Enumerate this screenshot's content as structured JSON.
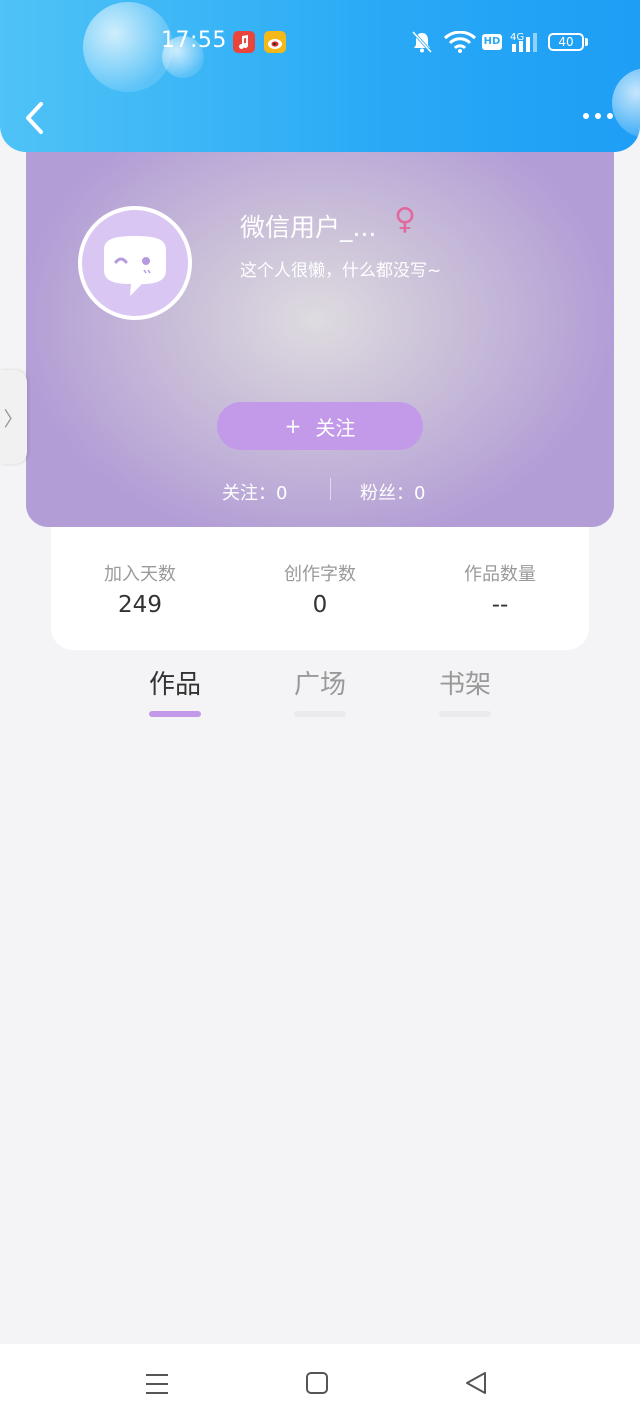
{
  "status_bar": {
    "time": "17:55",
    "battery": "40",
    "network": "4G",
    "hd_label": "HD",
    "app_icons": [
      "music-app-icon",
      "weibo-icon"
    ],
    "status_icons": [
      "bell-muted-icon",
      "wifi-icon",
      "hd-icon",
      "signal-4g-icon",
      "battery-icon"
    ]
  },
  "header": {
    "back_icon": "chevron-left-icon",
    "more_icon": "more-horizontal-icon",
    "colors": {
      "gradient_start": "#4fc3f7",
      "gradient_end": "#1e9ef5"
    }
  },
  "profile": {
    "username": "微信用户_...",
    "gender_symbol": "♀",
    "bio": "这个人很懒，什么都没写~",
    "follow_button": {
      "plus": "+",
      "label": "关注"
    },
    "following": {
      "label": "关注：",
      "value": "0"
    },
    "fans": {
      "label": "粉丝：",
      "value": "0"
    },
    "colors": {
      "card": "#b29dd6",
      "accent": "#c29ae9",
      "gender": "#e06a9c"
    }
  },
  "side_handle": {
    "glyph": "〉"
  },
  "stats": [
    {
      "label": "加入天数",
      "value": "249"
    },
    {
      "label": "创作字数",
      "value": "0"
    },
    {
      "label": "作品数量",
      "value": "--"
    }
  ],
  "tabs": [
    {
      "label": "作品",
      "active": true
    },
    {
      "label": "广场",
      "active": false
    },
    {
      "label": "书架",
      "active": false
    }
  ],
  "nav_bar": {
    "buttons": [
      "menu-icon",
      "home-square-icon",
      "back-triangle-icon"
    ]
  }
}
